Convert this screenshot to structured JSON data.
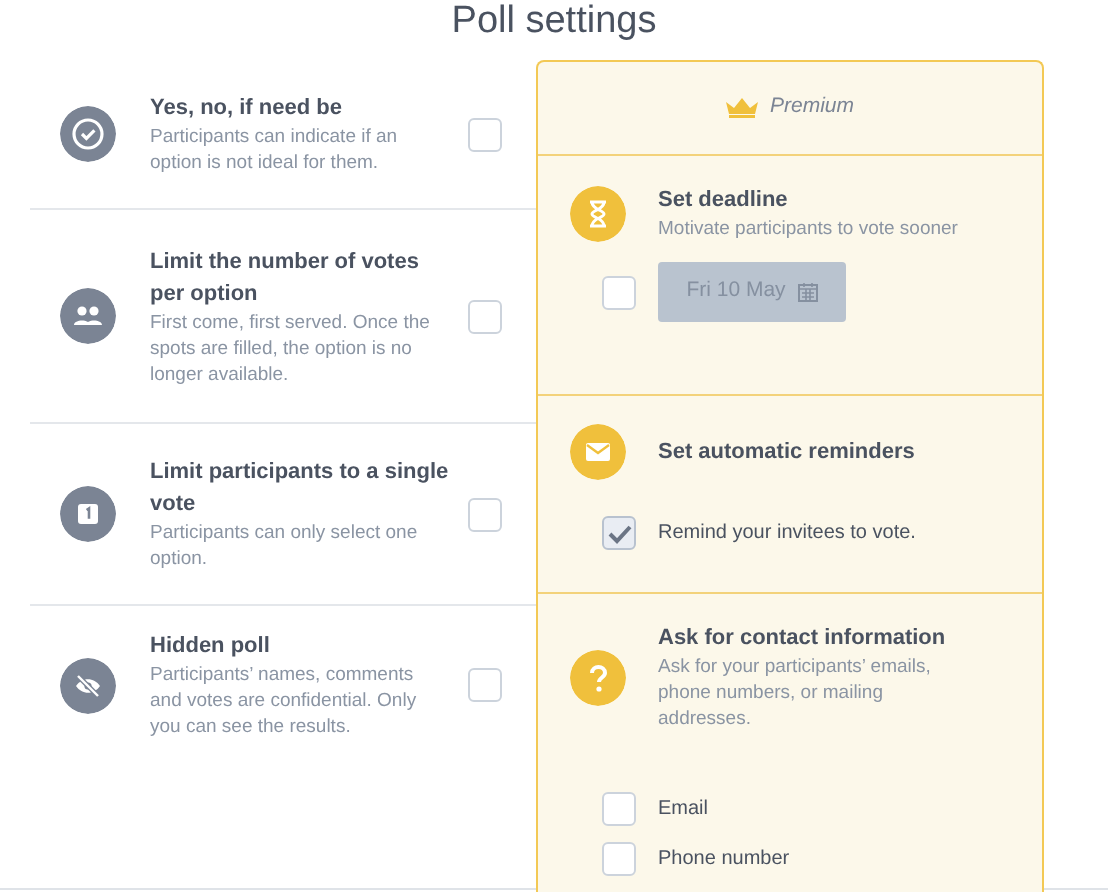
{
  "title": "Poll settings",
  "options": [
    {
      "title": "Yes, no, if need be",
      "description": "Participants can indicate if an option is not ideal for them.",
      "checked": false
    },
    {
      "title": "Limit the number of votes per option",
      "description": "First come, first served. Once the spots are filled, the option is no longer available.",
      "checked": false
    },
    {
      "title": "Limit participants to a single vote",
      "description": "Participants can only select one option.",
      "checked": false
    },
    {
      "title": "Hidden poll",
      "description": "Participants’ names, comments and votes are confidential. Only you can see the results.",
      "checked": false
    }
  ],
  "premium": {
    "label": "Premium",
    "sections": [
      {
        "kind": "deadline",
        "title": "Set deadline",
        "description": "Motivate participants to vote sooner",
        "checked": false,
        "date": "Fri 10 May"
      },
      {
        "kind": "reminders",
        "title": "Set automatic reminders",
        "items": [
          {
            "label": "Remind your invitees to vote.",
            "checked": true
          }
        ]
      },
      {
        "kind": "contact",
        "title": "Ask for contact information",
        "description": "Ask for your participants’ emails, phone numbers, or mailing addresses.",
        "items": [
          {
            "label": "Email",
            "checked": false
          },
          {
            "label": "Phone number",
            "checked": false
          }
        ]
      }
    ]
  }
}
